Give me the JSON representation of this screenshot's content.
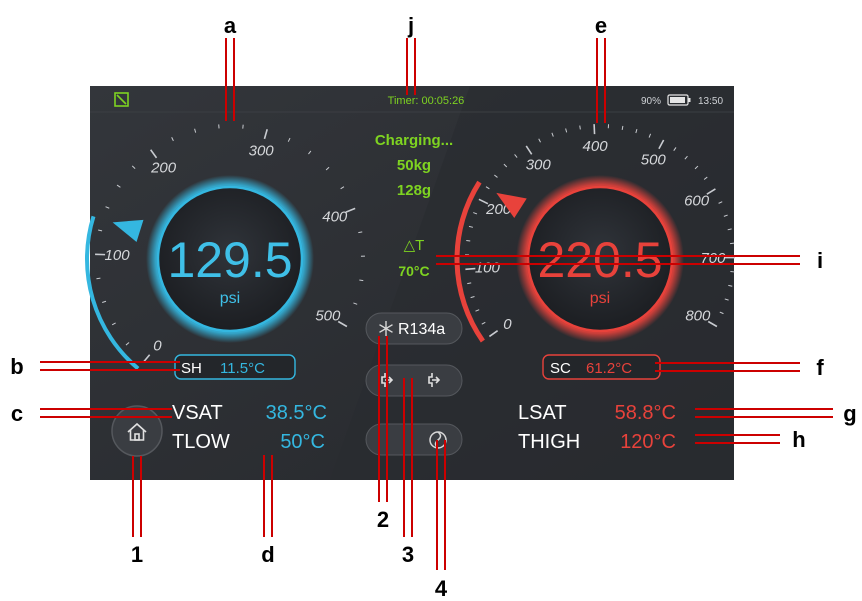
{
  "status_bar": {
    "timer": "Timer: 00:05:26",
    "battery": "90%",
    "time": "13:50",
    "left_icon": "edit-square-icon"
  },
  "center": {
    "charging": "Charging...",
    "weight_kg": "50kg",
    "weight_g": "128g",
    "delta_t_label": "△T",
    "delta_t_value": "70°C"
  },
  "low_gauge": {
    "value": 129.5,
    "value_text": "129.5",
    "unit": "psi",
    "ticks": [
      "0",
      "100",
      "200",
      "300",
      "400",
      "500"
    ],
    "badge_label": "SH",
    "badge_value": "11.5°C",
    "color": "#34b7e0"
  },
  "high_gauge": {
    "value": 220.5,
    "value_text": "220.5",
    "unit": "psi",
    "ticks": [
      "0",
      "100",
      "200",
      "300",
      "400",
      "500",
      "600",
      "700",
      "800"
    ],
    "badge_label": "SC",
    "badge_value": "61.2°C",
    "color": "#e8423b"
  },
  "left_readings": [
    {
      "label": "VSAT",
      "value": "38.5°C"
    },
    {
      "label": "TLOW",
      "value": "50°C"
    }
  ],
  "right_readings": [
    {
      "label": "LSAT",
      "value": "58.8°C"
    },
    {
      "label": "THIGH",
      "value": "120°C"
    }
  ],
  "buttons": {
    "home_icon": "home-icon",
    "refrigerant": "R134a",
    "refrigerant_icon": "snowflake-icon",
    "valves_icon": "valve-switch-icon",
    "fan_icon": "fan-icon"
  },
  "callouts": {
    "letters": [
      "a",
      "b",
      "c",
      "d",
      "e",
      "f",
      "g",
      "h",
      "i",
      "j"
    ],
    "numbers": [
      "1",
      "2",
      "3",
      "4"
    ]
  },
  "colors": {
    "green": "#7ed321",
    "cyan": "#34b7e0",
    "red": "#e8423b",
    "panel": "#2c2f33",
    "callout": "#cc0000"
  }
}
